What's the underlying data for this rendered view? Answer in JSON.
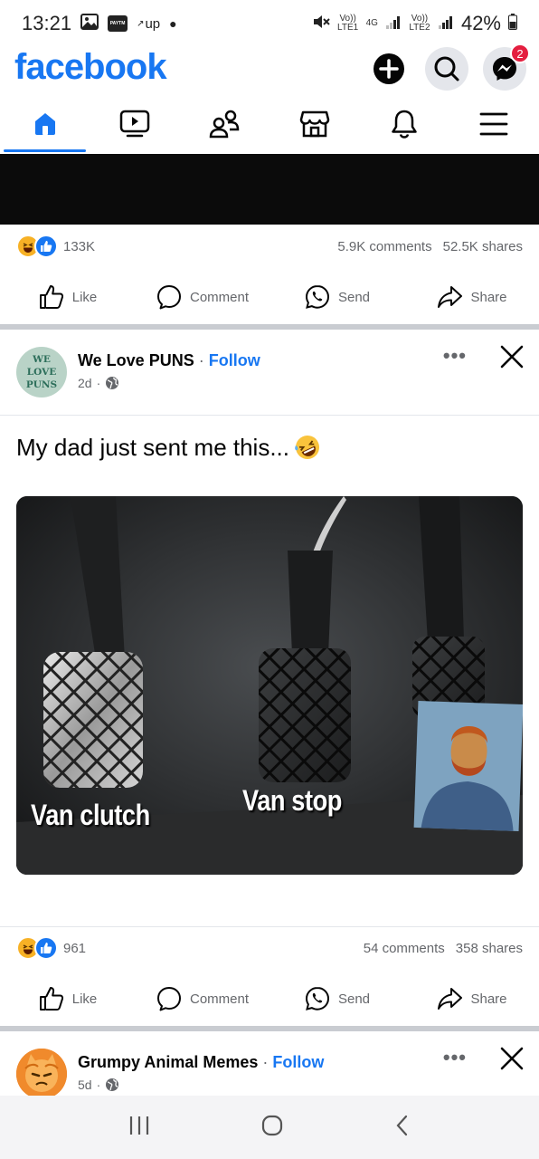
{
  "status_bar": {
    "time": "13:21",
    "carrier_badge": "PAYTM",
    "up_label": "up",
    "sim1_label": "Vo)) LTE1",
    "sim1_net": "4G",
    "sim2_label": "Vo)) LTE2",
    "battery": "42%"
  },
  "header": {
    "logo": "facebook",
    "messenger_badge": "2"
  },
  "colors": {
    "brand": "#1877f2",
    "badge": "#e41e3f",
    "meta_text": "#65676b"
  },
  "posts": [
    {
      "reaction_count": "133K",
      "comments": "5.9K comments",
      "shares": "52.5K shares"
    },
    {
      "page_name": "We Love PUNS",
      "avatar_lines": [
        "WE",
        "LOVE",
        "PUNS"
      ],
      "follow": "Follow",
      "separator": "·",
      "time": "2d",
      "text": "My dad just sent me this...",
      "image_captions": [
        "Van clutch",
        "Van stop"
      ],
      "reaction_count": "961",
      "comments": "54 comments",
      "shares": "358 shares"
    },
    {
      "page_name": "Grumpy Animal Memes",
      "follow": "Follow",
      "separator": "·",
      "time": "5d"
    }
  ],
  "actions": {
    "like": "Like",
    "comment": "Comment",
    "send": "Send",
    "share": "Share"
  },
  "more_glyph": "•••"
}
